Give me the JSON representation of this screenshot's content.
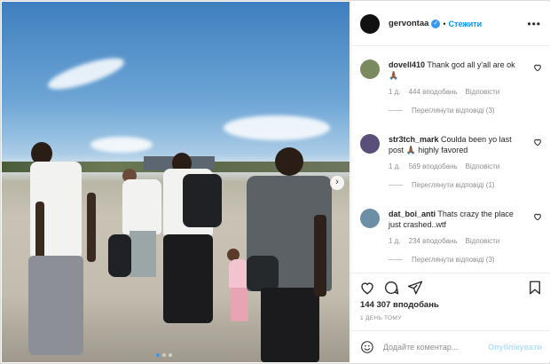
{
  "post": {
    "username": "gervontaa",
    "separator": "•",
    "follow_label": "Стежити",
    "more_label": "•••",
    "verified_glyph": "✓"
  },
  "comments": [
    {
      "user": "dovell410",
      "text": "Thank god all y'all are ok 🙏🏾",
      "time": "1 д.",
      "likes": "444 вподобань",
      "reply": "Відповісти",
      "view_replies": "Переглянути відповіді (3)",
      "avatar_color": "#7b8a5e"
    },
    {
      "user": "str3tch_mark",
      "text": "Coulda been yo last post 🙏🏾 highly favored",
      "time": "1 д.",
      "likes": "569 вподобань",
      "reply": "Відповісти",
      "view_replies": "Переглянути відповіді (1)",
      "avatar_color": "#5a4e7a"
    },
    {
      "user": "dat_boi_anti",
      "text": "Thats crazy the place just crashed..wtf",
      "time": "1 д.",
      "likes": "234 вподобань",
      "reply": "Відповісти",
      "view_replies": "Переглянути відповіді (3)",
      "avatar_color": "#6c8fa6"
    }
  ],
  "footer": {
    "likes": "144 307 вподобань",
    "time": "1 ДЕНЬ ТОМУ",
    "comment_placeholder": "Додайте коментар...",
    "publish_label": "Опублікувати"
  },
  "colors": {
    "accent": "#0095f6",
    "verified": "#3897f0",
    "muted": "#8e8e8e"
  },
  "icons": [
    "heart-icon",
    "comment-icon",
    "share-icon",
    "bookmark-icon",
    "emoji-icon",
    "more-icon",
    "verified-icon",
    "chevron-right-icon"
  ]
}
